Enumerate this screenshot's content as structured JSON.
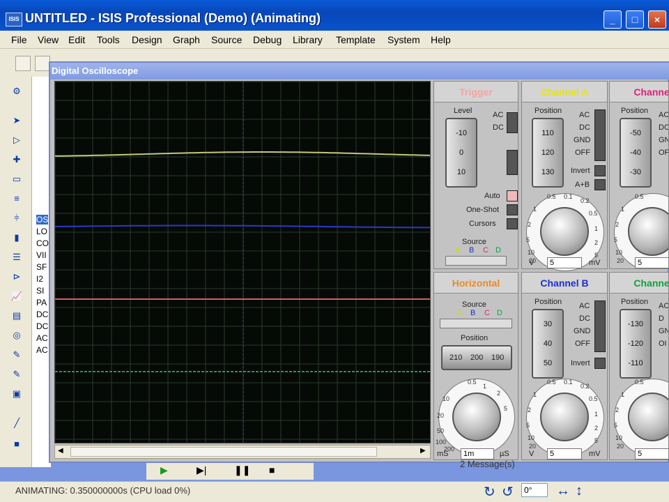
{
  "window": {
    "title": "UNTITLED - ISIS Professional (Demo) (Animating)",
    "logo": "ISIS"
  },
  "menu": [
    "File",
    "View",
    "Edit",
    "Tools",
    "Design",
    "Graph",
    "Source",
    "Debug",
    "Library",
    "Template",
    "System",
    "Help"
  ],
  "device_list": [
    "OS",
    "LO",
    "CO",
    "VII",
    "SF",
    "I2",
    "SI",
    "PA",
    "DC",
    "DC",
    "AC",
    "AC"
  ],
  "oscilloscope": {
    "title": "Digital Oscilloscope",
    "trace_colors": {
      "a": "#c8c87a",
      "b": "#2b39c8",
      "c": "#d46060",
      "d": "#2f8f63"
    },
    "trigger": {
      "title": "Trigger",
      "level_label": "Level",
      "level_scale": [
        "-10",
        "0",
        "10"
      ],
      "coupling": [
        "AC",
        "DC"
      ],
      "modes": [
        "Auto",
        "One-Shot",
        "Cursors"
      ],
      "source_label": "Source",
      "source_channels": [
        "A",
        "B",
        "C",
        "D"
      ]
    },
    "horizontal": {
      "title": "Horizontal",
      "source_label": "Source",
      "source_channels": [
        "A",
        "B",
        "C",
        "D"
      ],
      "position_label": "Position",
      "position_scale": [
        "210",
        "200",
        "190"
      ],
      "timebase_value": "1m",
      "timebase_units": [
        "mS",
        "µS"
      ],
      "dial_ticks": [
        "0.5",
        "1",
        "2",
        "5",
        "10",
        "20",
        "50",
        "100",
        "200"
      ]
    },
    "channel_a": {
      "title": "Channel A",
      "color": "#e8e800",
      "position_label": "Position",
      "scale": [
        "110",
        "120",
        "130"
      ],
      "coupling": [
        "AC",
        "DC",
        "GND",
        "OFF"
      ],
      "extras": [
        "Invert",
        "A+B"
      ],
      "volts_value": "5",
      "units": [
        "V",
        "mV"
      ],
      "dial_ticks": [
        "0.5",
        "1",
        "2",
        "5",
        "10",
        "20",
        "0.1",
        "0.2",
        "0.5",
        "1",
        "2",
        "5"
      ]
    },
    "channel_b": {
      "title": "Channel B",
      "color": "#1c2fd0",
      "position_label": "Position",
      "scale": [
        "30",
        "40",
        "50"
      ],
      "coupling": [
        "AC",
        "DC",
        "GND",
        "OFF"
      ],
      "extras": [
        "Invert"
      ],
      "volts_value": "5",
      "units": [
        "V",
        "mV"
      ],
      "dial_ticks": [
        "0.5",
        "1",
        "2",
        "5",
        "10",
        "20",
        "0.1",
        "0.2",
        "0.5",
        "1",
        "2",
        "5"
      ]
    },
    "channel_c": {
      "title": "Channel",
      "color": "#e0207a",
      "position_label": "Position",
      "scale": [
        "-50",
        "-40",
        "-30"
      ],
      "coupling": [
        "AC",
        "DC",
        "GN",
        "OF"
      ],
      "volts_value": "5",
      "dial_ticks": [
        "0.5",
        "1",
        "2",
        "5",
        "10",
        "20"
      ]
    },
    "channel_d": {
      "title": "Channel",
      "color": "#10a040",
      "position_label": "Position",
      "scale": [
        "-130",
        "-120",
        "-110"
      ],
      "coupling": [
        "AC",
        "D",
        "GN",
        "OI"
      ],
      "volts_value": "5",
      "dial_ticks": [
        "0.5",
        "1",
        "2",
        "5",
        "10",
        "20"
      ]
    }
  },
  "status": {
    "text": "ANIMATING: 0.350000000s (CPU load 0%)",
    "messages": "2 Message(s)",
    "angle": "0°"
  }
}
